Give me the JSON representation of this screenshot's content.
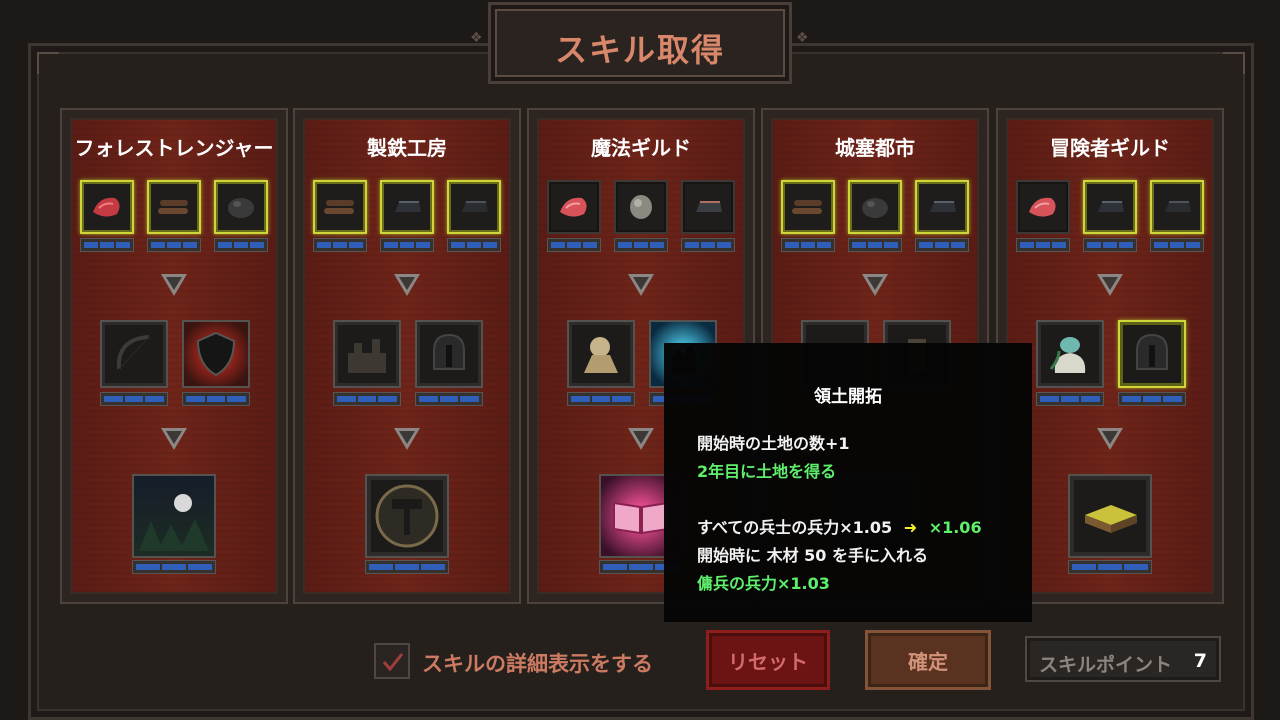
{
  "title": "スキル取得",
  "panels": [
    {
      "name": "フォレストレンジャー"
    },
    {
      "name": "製鉄工房"
    },
    {
      "name": "魔法ギルド"
    },
    {
      "name": "城塞都市"
    },
    {
      "name": "冒険者ギルド"
    }
  ],
  "tooltip": {
    "title": "領土開拓",
    "line1": "開始時の土地の数+1",
    "line2": "2年目に土地を得る",
    "line3_base": "すべての兵士の兵力×1.05",
    "line3_arrow": "➜",
    "line3_new": "×1.06",
    "line4": "開始時に 木材 50 を手に入れる",
    "line5": "傭兵の兵力×1.03"
  },
  "footer": {
    "checkbox_label": "スキルの詳細表示をする",
    "checkbox_checked": true,
    "reset_label": "リセット",
    "confirm_label": "確定",
    "points_label": "スキルポイント",
    "points_value": "7"
  },
  "colors": {
    "highlight": "#cfd63a",
    "bonus_green": "#5ef06c",
    "arrow_yellow": "#f7f12b",
    "bar_blue": "#2f5fb8"
  }
}
